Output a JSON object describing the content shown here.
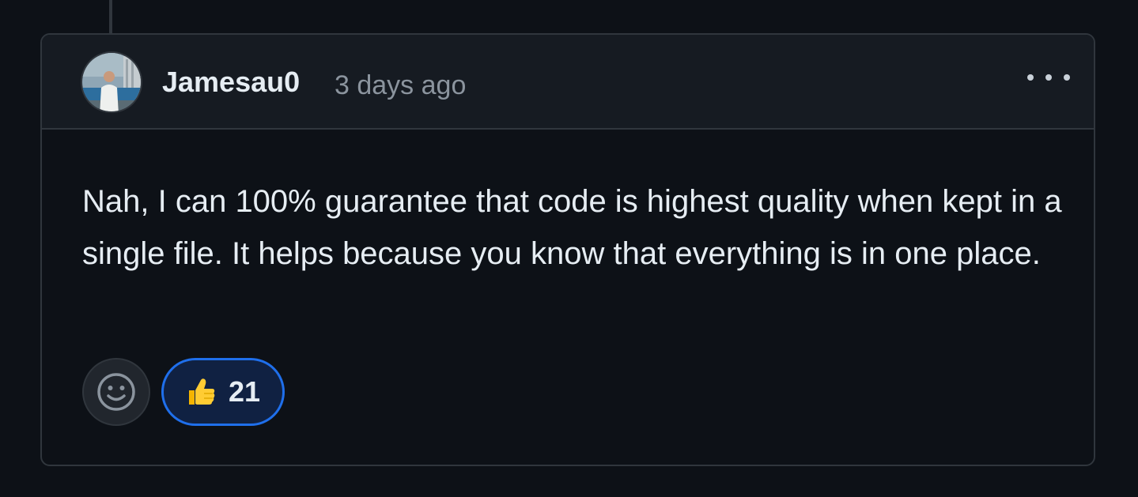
{
  "comment": {
    "author": "Jamesau0",
    "timestamp": "3 days ago",
    "body": "Nah, I can 100% guarantee that code is highest quality when kept in a single file. It helps because you know that everything is in one place.",
    "more_actions_icon": "kebab-horizontal-icon",
    "avatar_icon": "user-avatar"
  },
  "reactions": {
    "add_reaction_icon": "smiley-icon",
    "items": [
      {
        "emoji": "thumbs-up-icon",
        "count": "21"
      }
    ]
  },
  "colors": {
    "background": "#0d1117",
    "header_background": "#161b22",
    "border": "#30363d",
    "text_primary": "#e6edf3",
    "text_muted": "#8b949e",
    "accent": "#1f6feb",
    "reaction_active_bg": "#102142"
  }
}
